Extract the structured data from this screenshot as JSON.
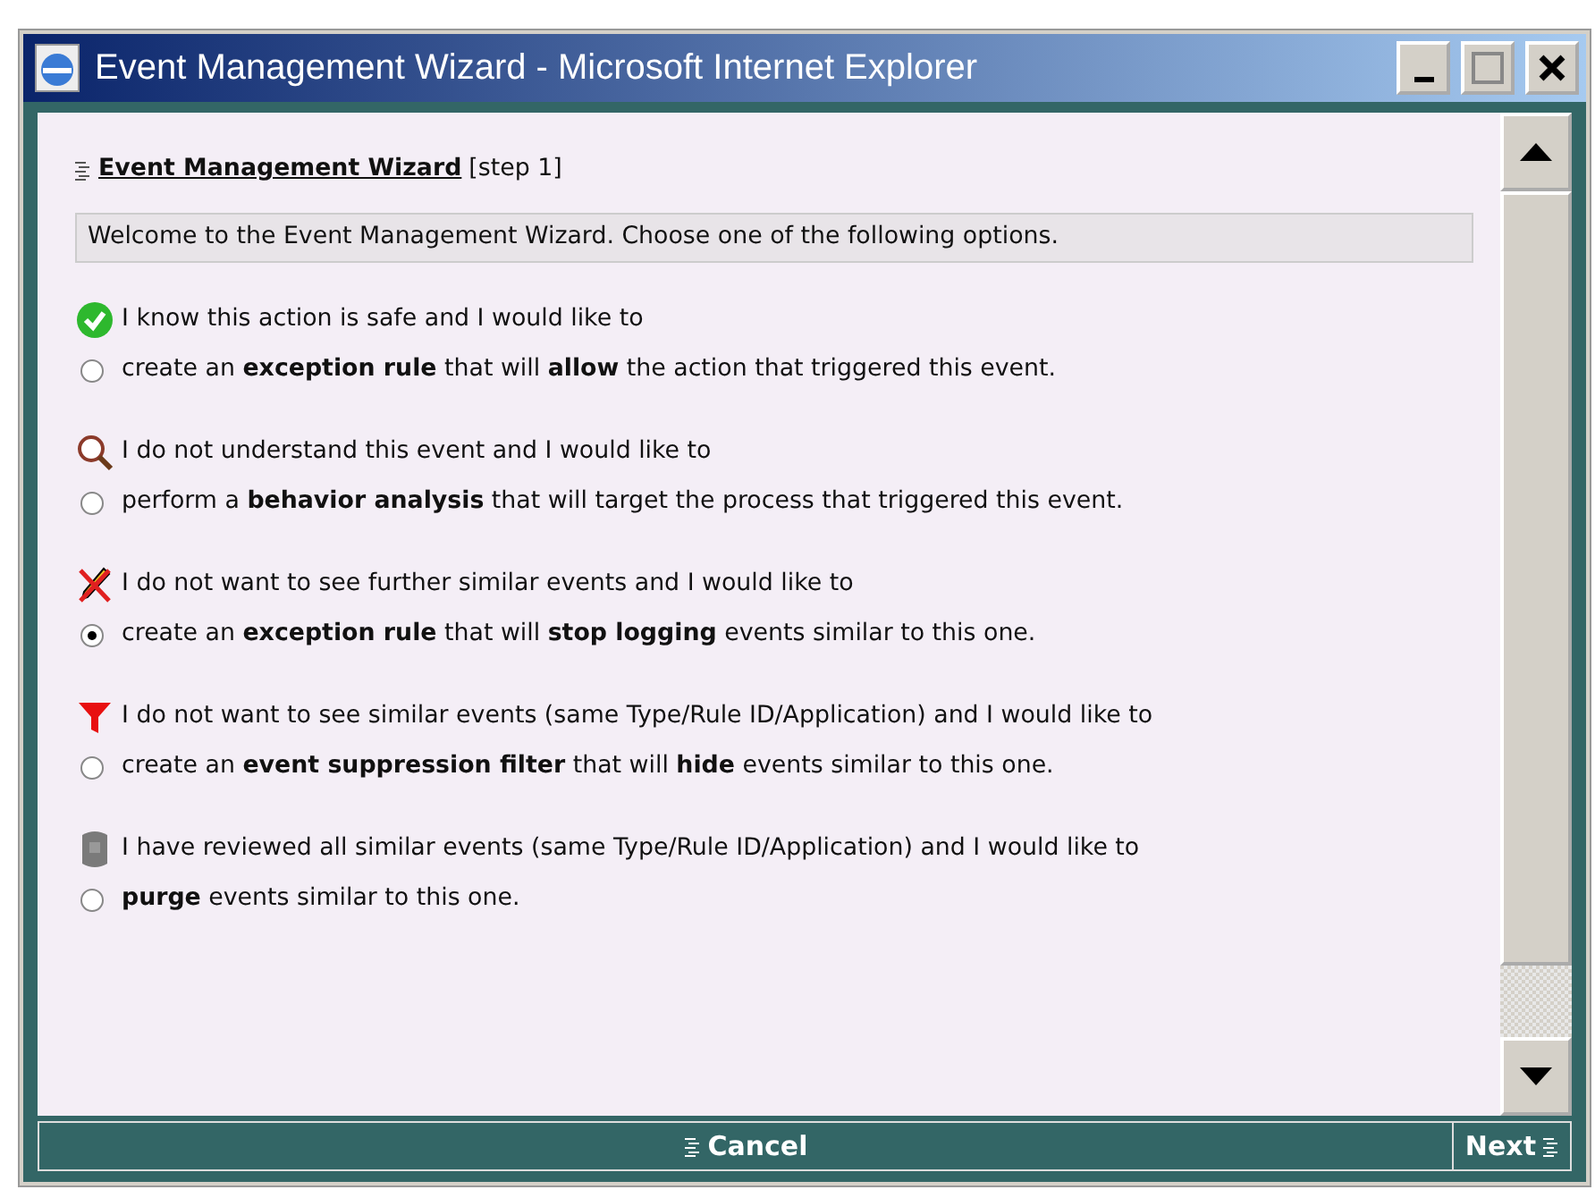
{
  "window": {
    "title": "Event Management Wizard - Microsoft Internet Explorer"
  },
  "header": {
    "title": "Event Management Wizard",
    "step": "[step 1]"
  },
  "welcome": "Welcome to the Event Management Wizard. Choose one of the following options.",
  "options": [
    {
      "kind": "check",
      "intro": "I know this action is safe and I would like to",
      "choice": "create an **exception rule** that will **allow** the action that triggered this event.",
      "selected": false
    },
    {
      "kind": "magnifier",
      "intro": "I do not understand this event and I would like to",
      "choice": "perform a **behavior analysis** that will target the process that triggered this event.",
      "selected": false
    },
    {
      "kind": "pen-crossed",
      "intro": "I do not want to see further similar events and I would like to",
      "choice": "create an **exception rule** that will **stop logging** events similar to this one.",
      "selected": true
    },
    {
      "kind": "filter",
      "intro": "I do not want to see similar events (same Type/Rule ID/Application) and I would like to",
      "choice": "create an **event suppression filter** that will **hide** events similar to this one.",
      "selected": false
    },
    {
      "kind": "bin",
      "intro": "I have reviewed all similar events (same Type/Rule ID/Application) and I would like to",
      "choice": "**purge** events similar to this one.",
      "selected": false
    }
  ],
  "footer": {
    "cancel": "Cancel",
    "next": "Next"
  }
}
